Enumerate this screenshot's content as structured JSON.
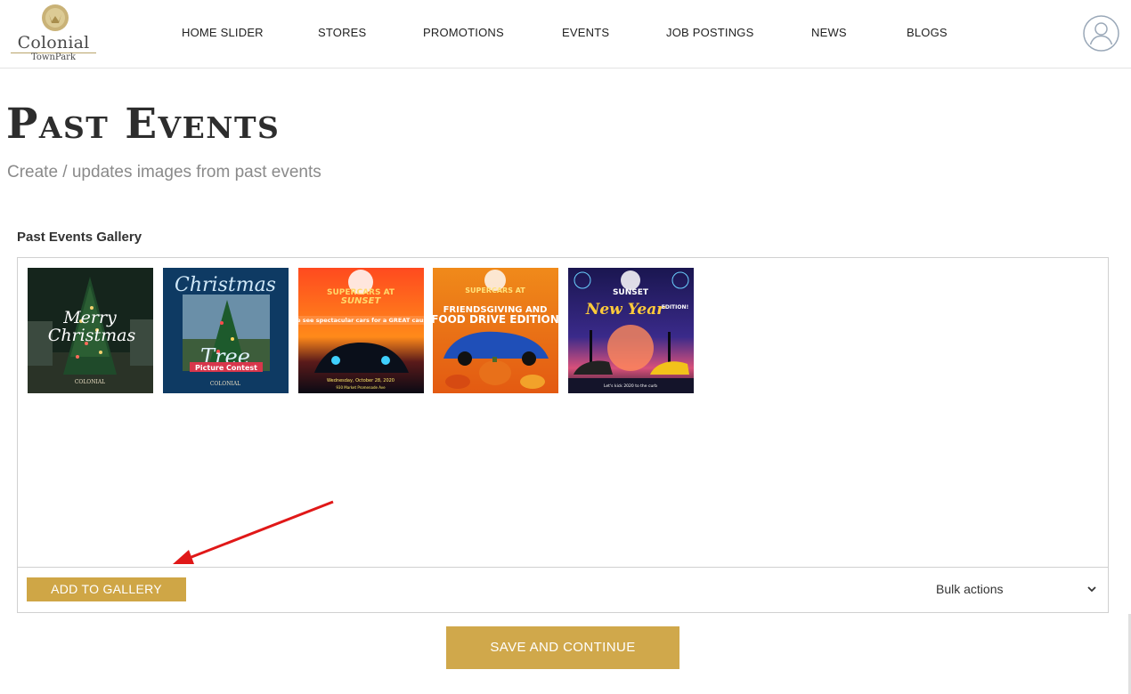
{
  "brand": {
    "name": "Colonial",
    "sub": "TownPark",
    "gold": "#cfa646"
  },
  "nav": {
    "items": [
      {
        "label": "HOME SLIDER"
      },
      {
        "label": "STORES"
      },
      {
        "label": "PROMOTIONS"
      },
      {
        "label": "EVENTS"
      },
      {
        "label": "JOB POSTINGS"
      },
      {
        "label": "NEWS"
      },
      {
        "label": "BLOGS"
      }
    ],
    "avatar_icon": "user-avatar-icon"
  },
  "page": {
    "title": "Past Events",
    "subtitle": "Create / updates images from past events"
  },
  "gallery": {
    "label": "Past Events Gallery",
    "images": [
      {
        "name": "merry-christmas-image",
        "caption": "Merry Christmas"
      },
      {
        "name": "christmas-tree-contest-image",
        "caption": "Christmas",
        "caption2": "Tree",
        "caption3": "Picture Contest"
      },
      {
        "name": "supercars-at-sunset-october-image",
        "caption": "SUPERCARS AT SUNSET"
      },
      {
        "name": "friendsgiving-food-drive-image",
        "caption": "FRIENDSGIVING AND",
        "caption2": "FOOD DRIVE EDITION"
      },
      {
        "name": "new-year-edition-image",
        "caption": "SUNSET",
        "caption2": "New Year",
        "caption3": "EDITION!"
      }
    ],
    "add_label": "ADD TO GALLERY",
    "bulk_label": "Bulk actions"
  },
  "actions": {
    "save_label": "SAVE AND CONTINUE"
  }
}
